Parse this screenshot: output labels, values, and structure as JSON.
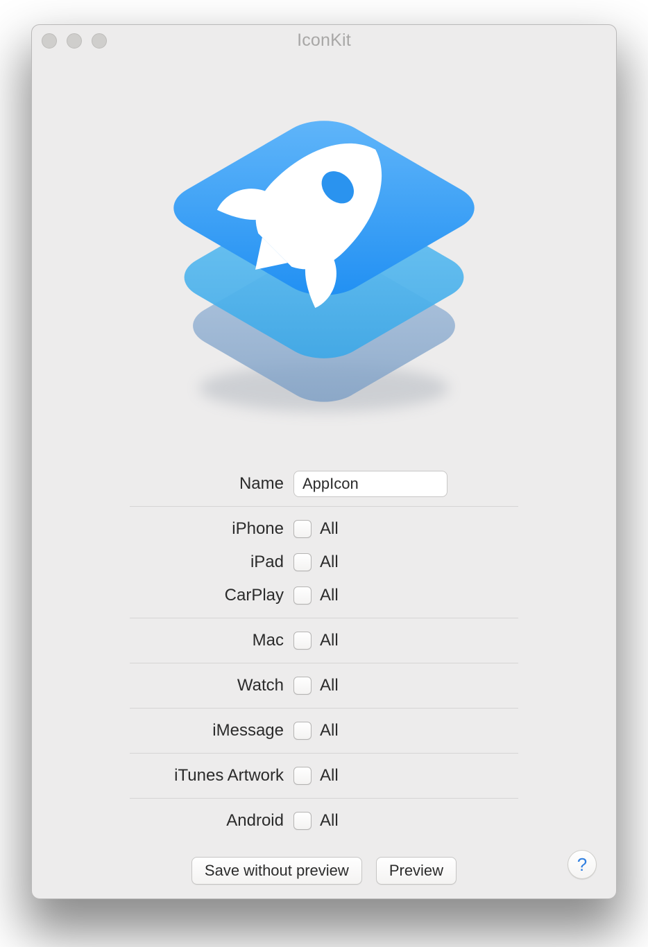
{
  "window": {
    "title": "IconKit"
  },
  "form": {
    "name_label": "Name",
    "name_value": "AppIcon",
    "all_label": "All",
    "rows": {
      "iphone": "iPhone",
      "ipad": "iPad",
      "carplay": "CarPlay",
      "mac": "Mac",
      "watch": "Watch",
      "imessage": "iMessage",
      "itunes": "iTunes Artwork",
      "android": "Android"
    }
  },
  "buttons": {
    "save_without_preview": "Save without preview",
    "preview": "Preview"
  },
  "help_label": "?"
}
